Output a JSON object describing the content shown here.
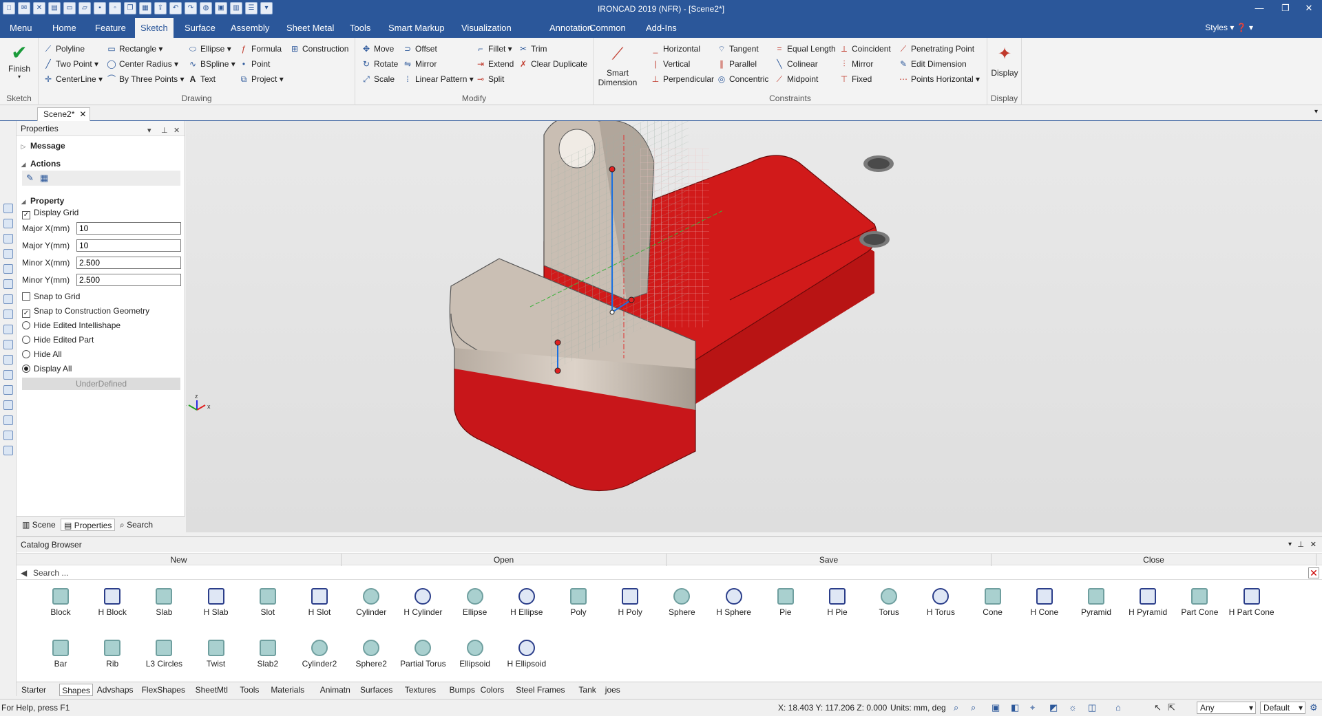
{
  "app": {
    "title": "IRONCAD 2019 (NFR) - [Scene2*]"
  },
  "menu": {
    "tabs": [
      "Menu",
      "Home",
      "Feature",
      "Sketch",
      "Surface",
      "Assembly",
      "Sheet Metal",
      "Tools",
      "Smart Markup",
      "Visualization",
      "Annotation",
      "Common",
      "Add-Ins"
    ],
    "active": "Sketch",
    "styles_label": "Styles"
  },
  "ribbon": {
    "sketch": {
      "finish": "Finish",
      "label": "Sketch"
    },
    "drawing": {
      "label": "Drawing",
      "items": [
        "Polyline",
        "Two Point",
        "CenterLine",
        "Rectangle",
        "Center Radius",
        "By Three Points",
        "Ellipse",
        "BSpline",
        "Text",
        "Formula",
        "Point",
        "Project",
        "Construction"
      ]
    },
    "modify": {
      "label": "Modify",
      "items": [
        "Move",
        "Rotate",
        "Scale",
        "Offset",
        "Mirror",
        "Linear Pattern",
        "Fillet",
        "Extend",
        "Split",
        "Trim",
        "Clear Duplicate"
      ]
    },
    "constraints": {
      "label": "Constraints",
      "smart_dimension": "Smart Dimension",
      "items": [
        "Horizontal",
        "Vertical",
        "Perpendicular",
        "Tangent",
        "Parallel",
        "Concentric",
        "Equal Length",
        "Colinear",
        "Midpoint",
        "Coincident",
        "Mirror",
        "Fixed",
        "Penetrating Point",
        "Edit Dimension",
        "Points Horizontal"
      ]
    },
    "display": {
      "button": "Display",
      "label": "Display"
    }
  },
  "doc_tab": {
    "label": "Scene2*"
  },
  "properties": {
    "title": "Properties",
    "sections": {
      "message": "Message",
      "actions": "Actions",
      "property": "Property"
    },
    "display_grid": "Display Grid",
    "fields": [
      {
        "label": "Major X(mm)",
        "value": "10"
      },
      {
        "label": "Major Y(mm)",
        "value": "10"
      },
      {
        "label": "Minor X(mm)",
        "value": "2.500"
      },
      {
        "label": "Minor Y(mm)",
        "value": "2.500"
      }
    ],
    "snap_grid": "Snap to Grid",
    "snap_construction": "Snap to Construction Geometry",
    "radios": [
      "Hide Edited Intellishape",
      "Hide Edited Part",
      "Hide All",
      "Display All"
    ],
    "status_button": "UnderDefined",
    "tabs": [
      "Scene",
      "Properties",
      "Search"
    ]
  },
  "viewport": {
    "axis_z": "z",
    "axis_x": "x",
    "axis_y": "y"
  },
  "catalog": {
    "title": "Catalog Browser",
    "buttons": [
      "New",
      "Open",
      "Save",
      "Close"
    ],
    "search_placeholder": "Search ...",
    "row1": [
      "Block",
      "H Block",
      "Slab",
      "H Slab",
      "Slot",
      "H Slot",
      "Cylinder",
      "H Cylinder",
      "Ellipse",
      "H Ellipse",
      "Poly",
      "H Poly",
      "Sphere",
      "H Sphere",
      "Pie",
      "H Pie",
      "Torus",
      "H Torus",
      "Cone",
      "H Cone",
      "Pyramid",
      "H Pyramid",
      "Part Cone",
      "H Part Cone"
    ],
    "row2": [
      "Bar",
      "Rib",
      "L3 Circles",
      "Twist",
      "Slab2",
      "Cylinder2",
      "Sphere2",
      "Partial Torus",
      "Ellipsoid",
      "H Ellipsoid"
    ],
    "tabs": [
      "Starter",
      "Shapes",
      "Advshaps",
      "FlexShapes",
      "SheetMtl",
      "Tools",
      "Materials",
      "Animatn",
      "Surfaces",
      "Textures",
      "Bumps",
      "Colors",
      "Steel Frames",
      "Tank",
      "joes"
    ],
    "active_tab": "Shapes"
  },
  "status": {
    "help": "For Help, press F1",
    "coords": "X: 18.403 Y: 117.206 Z: 0.000",
    "units": "Units: mm, deg",
    "filter": "Any",
    "style": "Default"
  },
  "colors": {
    "accent": "#2b579a",
    "part_red": "#d11a1a",
    "part_tan": "#c9beb3",
    "sketch_blue": "#1a6fe0"
  }
}
